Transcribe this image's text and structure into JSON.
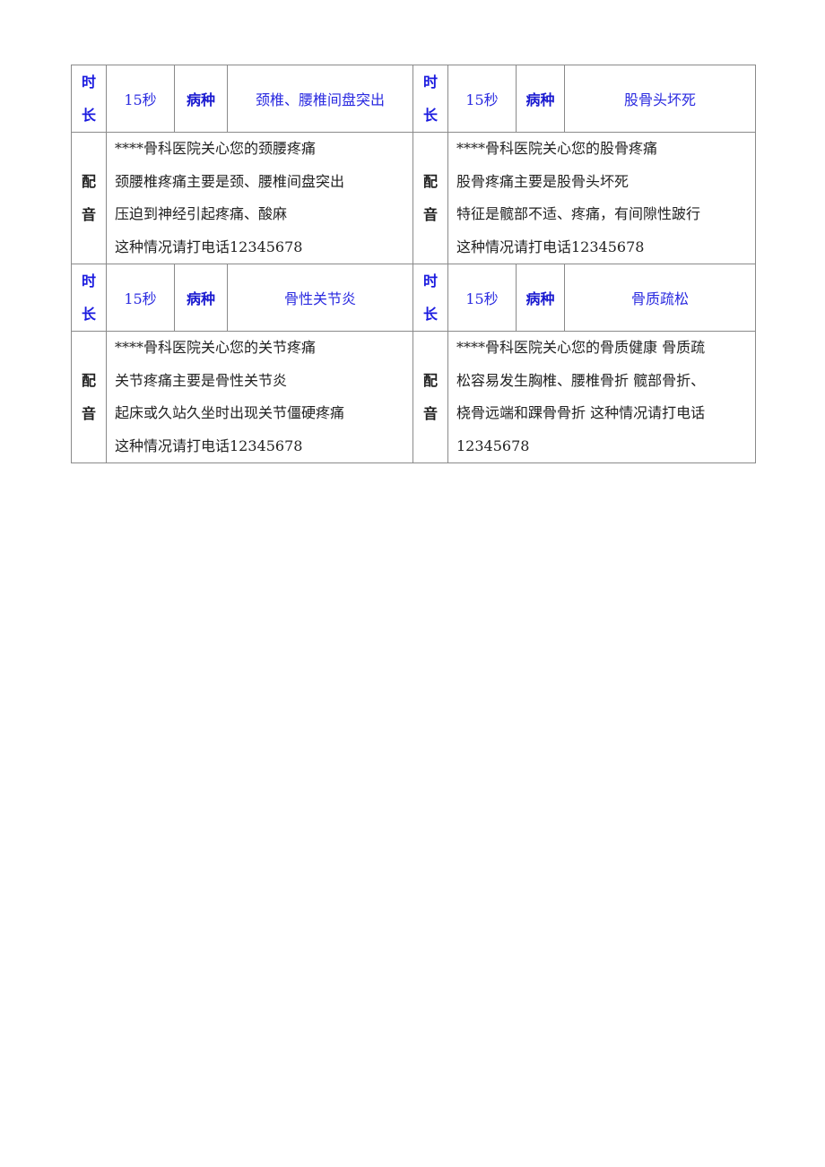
{
  "labels": {
    "duration_label_chars": [
      "时",
      "长"
    ],
    "voice_label_chars": [
      "配",
      "音"
    ],
    "disease_label": "病种"
  },
  "colors": {
    "label_blue": "#1a1adf",
    "value_blue": "#2a2ae0",
    "body_text": "#222222",
    "border": "#8a8a8a"
  },
  "entries": [
    {
      "duration": "15秒",
      "disease": "颈椎、腰椎间盘突出",
      "voice_lines": [
        "****骨科医院关心您的颈腰疼痛",
        "颈腰椎疼痛主要是颈、腰椎间盘突出",
        "压迫到神经引起疼痛、酸麻",
        "这种情况请打电话12345678"
      ]
    },
    {
      "duration": "15秒",
      "disease": "股骨头坏死",
      "voice_lines": [
        "****骨科医院关心您的股骨疼痛",
        "股骨疼痛主要是股骨头坏死",
        "特征是髋部不适、疼痛，有间隙性跛行",
        "这种情况请打电话12345678"
      ]
    },
    {
      "duration": "15秒",
      "disease": "骨性关节炎",
      "voice_lines": [
        "****骨科医院关心您的关节疼痛",
        "关节疼痛主要是骨性关节炎",
        "起床或久站久坐时出现关节僵硬疼痛",
        "这种情况请打电话12345678"
      ]
    },
    {
      "duration": "15秒",
      "disease": "骨质疏松",
      "voice_lines": [
        "****骨科医院关心您的骨质健康 骨质疏",
        "松容易发生胸椎、腰椎骨折 髋部骨折、",
        "桡骨远端和踝骨骨折 这种情况请打电话",
        "12345678"
      ]
    }
  ]
}
